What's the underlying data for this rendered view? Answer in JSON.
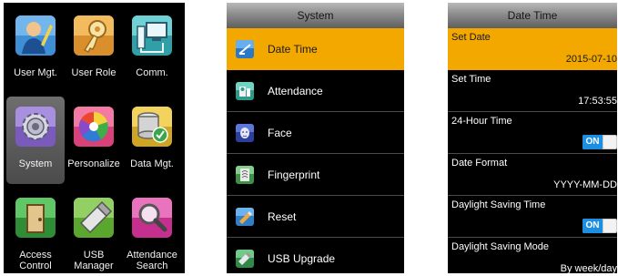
{
  "main_menu": {
    "items": [
      {
        "label": "User Mgt.",
        "icon": "user-management-icon"
      },
      {
        "label": "User Role",
        "icon": "key-icon"
      },
      {
        "label": "Comm.",
        "icon": "network-computer-icon"
      },
      {
        "label": "System",
        "icon": "gear-icon"
      },
      {
        "label": "Personalize",
        "icon": "color-wheel-icon"
      },
      {
        "label": "Data Mgt.",
        "icon": "database-check-icon"
      },
      {
        "label": "Access\nControl",
        "icon": "door-icon"
      },
      {
        "label": "USB\nManager",
        "icon": "usb-drive-icon"
      },
      {
        "label": "Attendance\nSearch",
        "icon": "magnifier-icon"
      }
    ],
    "selected": "System"
  },
  "system_menu": {
    "title": "System",
    "items": [
      {
        "label": "Date Time",
        "icon": "clock-icon"
      },
      {
        "label": "Attendance",
        "icon": "attendance-icon"
      },
      {
        "label": "Face",
        "icon": "face-icon"
      },
      {
        "label": "Fingerprint",
        "icon": "fingerprint-icon"
      },
      {
        "label": "Reset",
        "icon": "reset-icon"
      },
      {
        "label": "USB Upgrade",
        "icon": "usb-upgrade-icon"
      }
    ],
    "selected": "Date Time"
  },
  "date_time": {
    "title": "Date Time",
    "rows": [
      {
        "label": "Set Date",
        "value": "2015-07-10"
      },
      {
        "label": "Set Time",
        "value": "17:53:55"
      },
      {
        "label": "24-Hour Time",
        "toggle": "ON"
      },
      {
        "label": "Date Format",
        "value": "YYYY-MM-DD"
      },
      {
        "label": "Daylight Saving Time",
        "toggle": "ON"
      },
      {
        "label": "Daylight Saving Mode",
        "value": "By week/day"
      }
    ],
    "selected": "Set Date"
  },
  "colors": {
    "highlight": "#f3a800",
    "toggle_on": "#1d8fe3",
    "background": "#000000"
  }
}
